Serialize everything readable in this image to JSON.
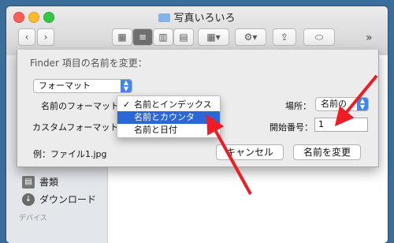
{
  "window": {
    "title": "写真いろいろ",
    "toolbar": {
      "back_icon": "chevron-left-icon",
      "forward_icon": "chevron-right-icon",
      "view_modes": [
        "icon-view-icon",
        "list-view-icon",
        "column-view-icon",
        "coverflow-view-icon"
      ],
      "selected_view": "list-view-icon",
      "more_label": "»"
    }
  },
  "sidebar": {
    "items": [
      {
        "label": "書類",
        "icon": "document-icon"
      },
      {
        "label": "ダウンロード",
        "icon": "download-icon"
      }
    ],
    "section_header": "デバイス"
  },
  "dialog": {
    "title": "Finder 項目の名前を変更：",
    "mode_popup": "フォーマット",
    "name_format_label": "名前のフォーマット：",
    "custom_format_label": "カスタムフォーマット：",
    "location_label": "場所：",
    "location_value": "名前の",
    "start_number_label": "開始番号：",
    "start_number_value": "1",
    "example_text": "例：ファイル1.jpg",
    "cancel_label": "キャンセル",
    "rename_label": "名前を変更"
  },
  "format_menu": {
    "items": [
      {
        "label": "名前とインデックス",
        "checked": true
      },
      {
        "label": "名前とカウンタ",
        "highlighted": true
      },
      {
        "label": "名前と日付"
      }
    ],
    "checkmark": "✓"
  },
  "colors": {
    "desktop": "#3a6d9a",
    "accent": "#2b67d6",
    "annotation_arrow": "#ee1c25"
  }
}
